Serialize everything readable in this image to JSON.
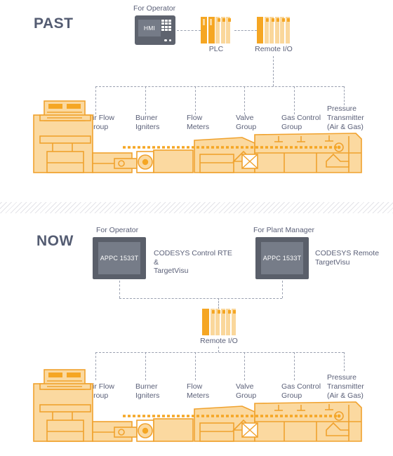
{
  "meta": {
    "accent_orange": "#f5a623",
    "accent_orange_light": "#fad79b",
    "text_slate": "#5b6078",
    "device_dark": "#5a5f6a"
  },
  "past": {
    "era_label": "PAST",
    "operator_caption": "For Operator",
    "hmi_label": "HMI",
    "plc_label": "PLC",
    "remote_io_label": "Remote I/O",
    "leaves": [
      "Air Flow\nGroup",
      "Burner\nIgniters",
      "Flow\nMeters",
      "Valve\nGroup",
      "Gas Control\nGroup",
      "Pressure\nTransmitter\n(Air & Gas)"
    ],
    "leaf_lines": [
      [
        "Air Flow",
        "Group"
      ],
      [
        "Burner",
        "Igniters"
      ],
      [
        "Flow",
        "Meters"
      ],
      [
        "Valve",
        "Group"
      ],
      [
        "Gas Control",
        "Group"
      ],
      [
        "Pressure",
        "Transmitter",
        "(Air & Gas)"
      ]
    ]
  },
  "now": {
    "era_label": "NOW",
    "operator_caption": "For Operator",
    "plant_manager_caption": "For Plant Manager",
    "operator_device_label": "APPC 1533T",
    "plant_manager_device_label": "APPC 1533T",
    "operator_software_line1": "CODESYS Control RTE &",
    "operator_software_line2": "TargetVisu",
    "plant_manager_software_line1": "CODESYS Remote",
    "plant_manager_software_line2": "TargetVisu",
    "remote_io_label": "Remote I/O",
    "leaf_lines": [
      [
        "Air Flow",
        "Group"
      ],
      [
        "Burner",
        "Igniters"
      ],
      [
        "Flow",
        "Meters"
      ],
      [
        "Valve",
        "Group"
      ],
      [
        "Gas Control",
        "Group"
      ],
      [
        "Pressure",
        "Transmitter",
        "(Air & Gas)"
      ]
    ]
  }
}
